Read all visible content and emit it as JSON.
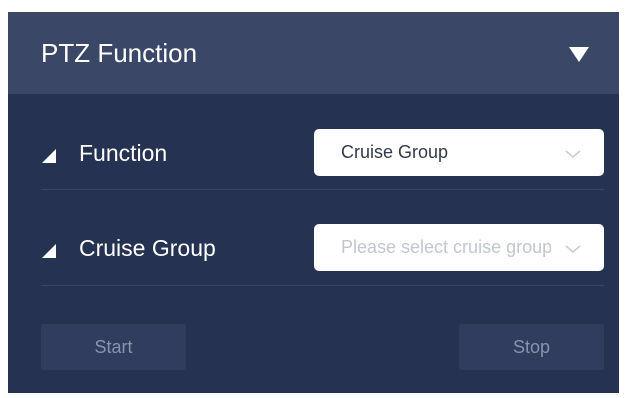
{
  "panel": {
    "title": "PTZ Function",
    "collapse_icon": "caret-down-icon"
  },
  "rows": [
    {
      "label": "Function",
      "select_value": "Cruise Group",
      "select_placeholder": ""
    },
    {
      "label": "Cruise Group",
      "select_value": "",
      "select_placeholder": "Please select cruise group"
    }
  ],
  "buttons": {
    "start_label": "Start",
    "stop_label": "Stop"
  },
  "colors": {
    "panel_bg": "#253252",
    "header_bg": "#3a4766",
    "button_bg": "#303d5f",
    "button_text": "#8993ac",
    "placeholder_text": "#c2c6ce"
  }
}
